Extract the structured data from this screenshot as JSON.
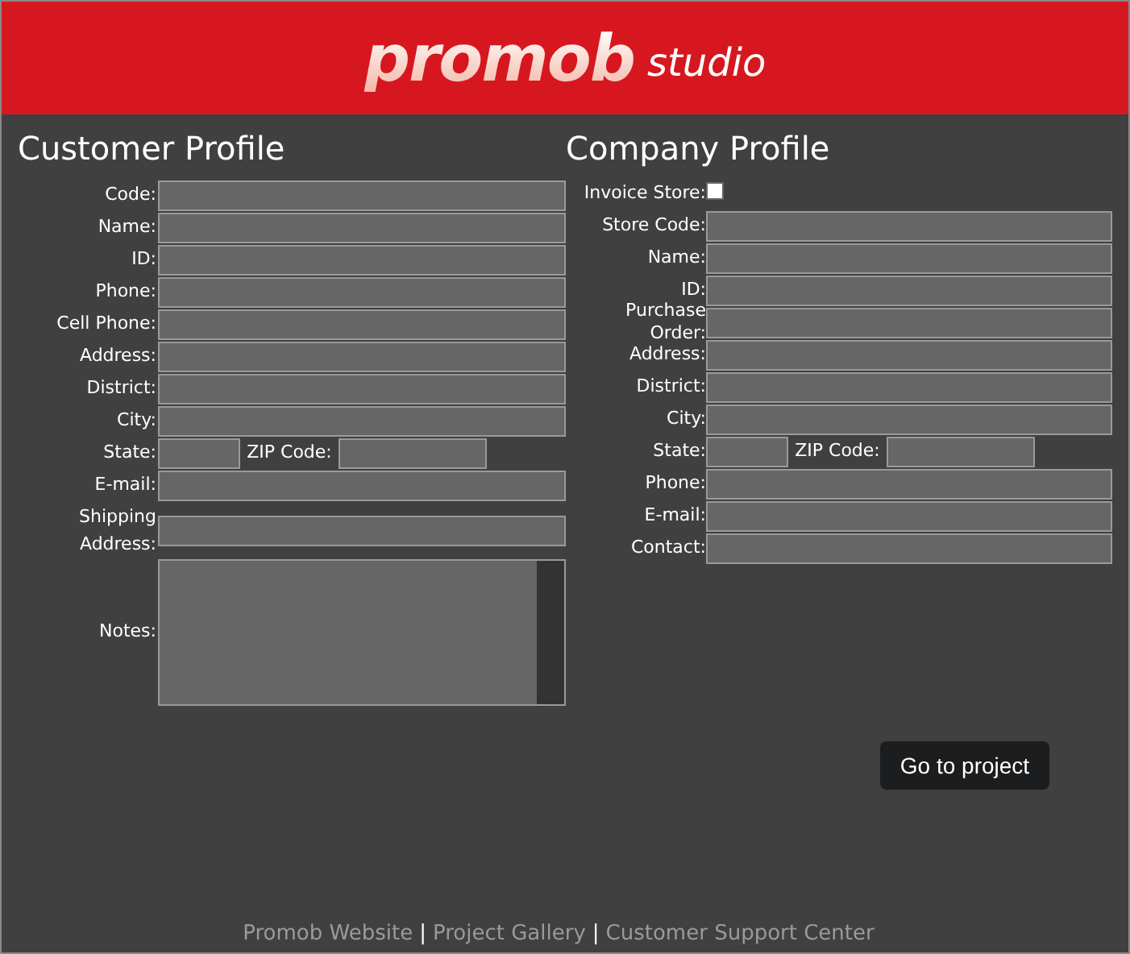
{
  "header": {
    "logo": "promob",
    "logo_suffix": "studio"
  },
  "customer_profile": {
    "title": "Customer Profile",
    "fields": [
      {
        "kind": "text",
        "label": "Code:"
      },
      {
        "kind": "text",
        "label": "Name:"
      },
      {
        "kind": "text",
        "label": "ID:"
      },
      {
        "kind": "text",
        "label": "Phone:"
      },
      {
        "kind": "text",
        "label": "Cell Phone:"
      },
      {
        "kind": "text",
        "label": "Address:"
      },
      {
        "kind": "text",
        "label": "District:"
      },
      {
        "kind": "text",
        "label": "City:"
      },
      {
        "kind": "state_zip",
        "label": "State:",
        "zip_label": "ZIP Code:"
      },
      {
        "kind": "text",
        "label": "E-mail:"
      },
      {
        "kind": "tall",
        "label": "Shipping Address:"
      },
      {
        "kind": "textarea",
        "label": "Notes:"
      }
    ]
  },
  "company_profile": {
    "title": "Company Profile",
    "fields": [
      {
        "kind": "checkbox",
        "label": "Invoice Store:",
        "checked": false
      },
      {
        "kind": "text",
        "label": "Store Code:"
      },
      {
        "kind": "text",
        "label": "Name:"
      },
      {
        "kind": "text",
        "label": "ID:"
      },
      {
        "kind": "text",
        "label": "Purchase Order:"
      },
      {
        "kind": "text",
        "label": "Address:"
      },
      {
        "kind": "text",
        "label": "District:"
      },
      {
        "kind": "text",
        "label": "City:"
      },
      {
        "kind": "state_zip",
        "label": "State:",
        "zip_label": "ZIP Code:"
      },
      {
        "kind": "text",
        "label": "Phone:"
      },
      {
        "kind": "text",
        "label": "E-mail:"
      },
      {
        "kind": "text",
        "label": "Contact:"
      }
    ]
  },
  "go_button": "Go to project",
  "footer_links": [
    {
      "kind": "link",
      "text": "Promob Website"
    },
    {
      "kind": "separator",
      "text": "|"
    },
    {
      "kind": "link",
      "text": "Project Gallery"
    },
    {
      "kind": "separator",
      "text": "|"
    },
    {
      "kind": "link",
      "text": "Customer Support Center"
    }
  ]
}
